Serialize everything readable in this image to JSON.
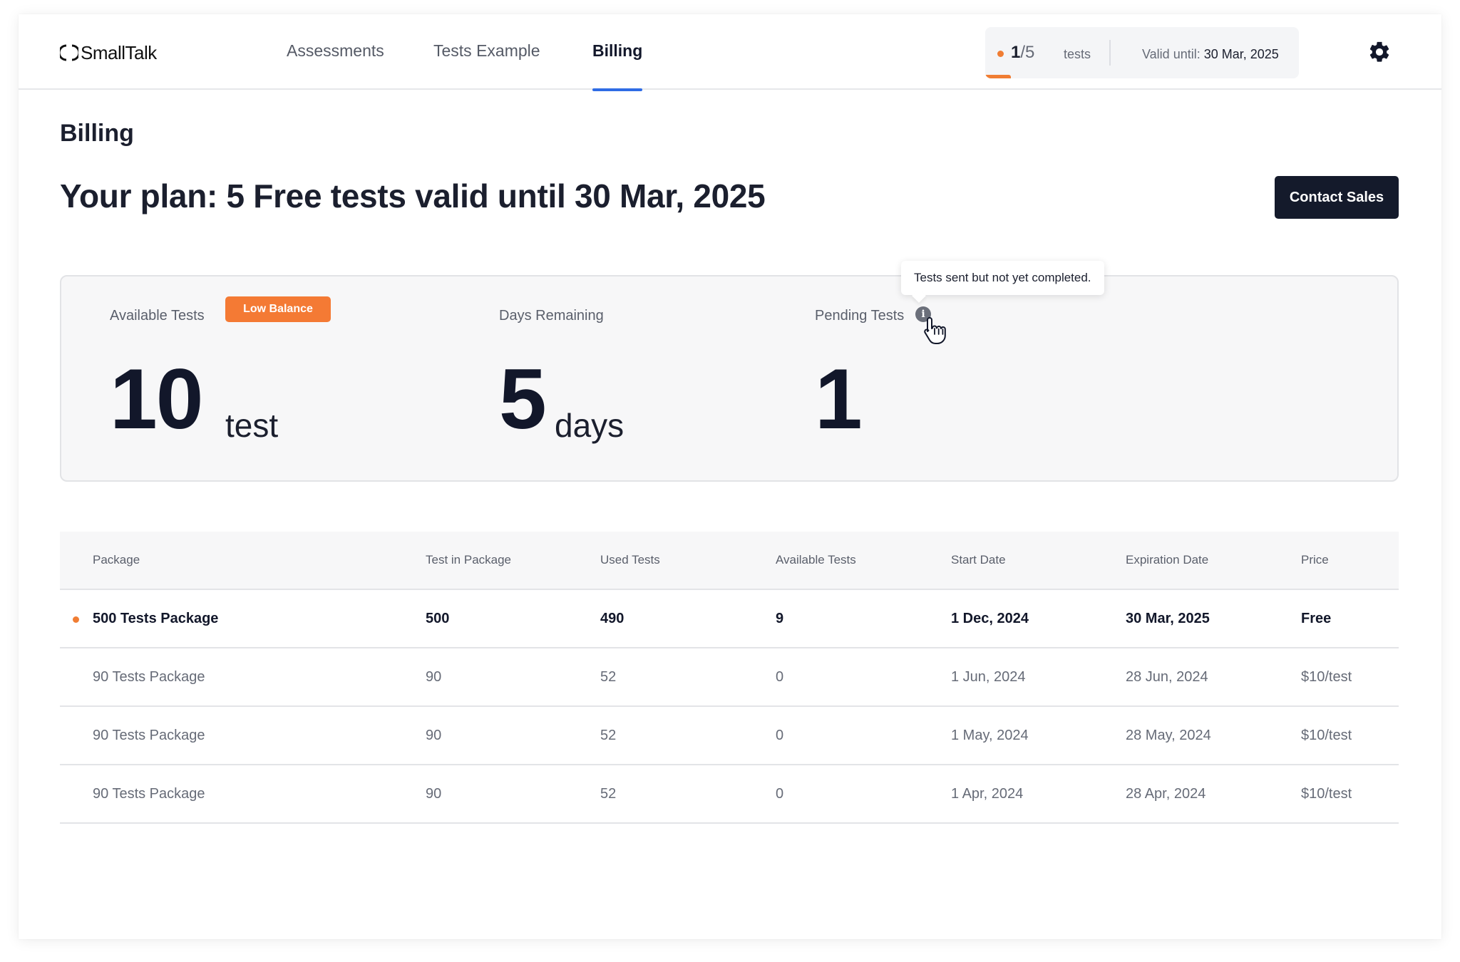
{
  "app": {
    "name": "SmallTalk"
  },
  "nav": {
    "tabs": [
      {
        "label": "Assessments"
      },
      {
        "label": "Tests Example"
      },
      {
        "label": "Billing"
      }
    ],
    "usage": {
      "used": "1",
      "total": "5",
      "unit": "tests",
      "valid_label": "Valid until:",
      "valid_date": "30 Mar, 2025",
      "accent": "#f07d33"
    }
  },
  "page": {
    "title": "Billing",
    "plan": "Your plan: 5 Free tests valid until 30 Mar, 2025",
    "contact_button": "Contact Sales"
  },
  "stats": {
    "available": {
      "label": "Available Tests",
      "badge": "Low Balance",
      "value": "10",
      "unit": "test"
    },
    "days": {
      "label": "Days Remaining",
      "value": "5",
      "unit": "days"
    },
    "pending": {
      "label": "Pending Tests",
      "value": "1",
      "info_icon": "i",
      "tooltip": "Tests sent but not yet completed."
    }
  },
  "table": {
    "headers": [
      "Package",
      "Test in Package",
      "Used Tests",
      "Available Tests",
      "Start Date",
      "Expiration Date",
      "Price"
    ],
    "rows": [
      {
        "current": true,
        "cells": [
          "500 Tests Package",
          "500",
          "490",
          "9",
          "1 Dec, 2024",
          "30 Mar, 2025",
          "Free"
        ]
      },
      {
        "current": false,
        "cells": [
          "90 Tests Package",
          "90",
          "52",
          "0",
          "1 Jun, 2024",
          "28 Jun, 2024",
          "$10/test"
        ]
      },
      {
        "current": false,
        "cells": [
          "90 Tests Package",
          "90",
          "52",
          "0",
          "1 May, 2024",
          "28 May, 2024",
          "$10/test"
        ]
      },
      {
        "current": false,
        "cells": [
          "90 Tests Package",
          "90",
          "52",
          "0",
          "1 Apr, 2024",
          "28 Apr, 2024",
          "$10/test"
        ]
      }
    ]
  },
  "colors": {
    "accent": "#f07d33",
    "primary_dark": "#141a2b",
    "tab_underline": "#2f6ce5"
  }
}
